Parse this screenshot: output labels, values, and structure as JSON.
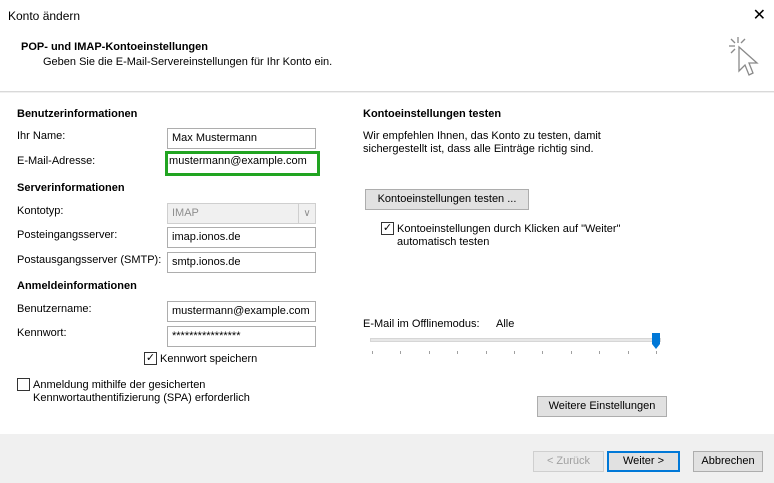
{
  "window": {
    "title": "Konto ändern",
    "close_glyph": "✕"
  },
  "header": {
    "title": "POP- und IMAP-Kontoeinstellungen",
    "subtitle": "Geben Sie die E-Mail-Servereinstellungen für Ihr Konto ein.",
    "icon": "wizard-cursor-icon"
  },
  "user_info": {
    "heading": "Benutzerinformationen",
    "name_label": "Ihr Name:",
    "name_value": "Max Mustermann",
    "email_label": "E-Mail-Adresse:",
    "email_value": "max.mustermann@example.com",
    "email_visible": ".mustermann@example.com"
  },
  "server_info": {
    "heading": "Serverinformationen",
    "type_label": "Kontotyp:",
    "type_value": "IMAP",
    "incoming_label": "Posteingangsserver:",
    "incoming_value": "imap.ionos.de",
    "outgoing_label": "Postausgangsserver (SMTP):",
    "outgoing_value": "smtp.ionos.de"
  },
  "login_info": {
    "heading": "Anmeldeinformationen",
    "username_label": "Benutzername:",
    "username_value": "mustermann@example.com",
    "password_label": "Kennwort:",
    "password_value": "****************",
    "remember_label": "Kennwort speichern",
    "remember_checked": true,
    "spa_line1": "Anmeldung mithilfe der gesicherten",
    "spa_line2": "Kennwortauthentifizierung (SPA) erforderlich",
    "spa_checked": false
  },
  "test_settings": {
    "heading": "Kontoeinstellungen testen",
    "desc_line1": "Wir empfehlen Ihnen, das Konto zu testen, damit",
    "desc_line2": "sichergestellt ist, dass alle Einträge richtig sind.",
    "test_button": "Kontoeinstellungen testen ...",
    "auto_test_line1": "Kontoeinstellungen durch Klicken auf \"Weiter\"",
    "auto_test_line2": "automatisch testen",
    "auto_test_checked": true
  },
  "offline": {
    "label": "E-Mail im Offlinemodus:",
    "value": "Alle",
    "slider_fraction": 1.0
  },
  "more_settings_button": "Weitere Einstellungen",
  "footer": {
    "back": "< Zurück",
    "next": "Weiter >",
    "cancel": "Abbrechen"
  },
  "colors": {
    "focus_border": "#21a421",
    "slider_thumb": "#0078d7"
  }
}
